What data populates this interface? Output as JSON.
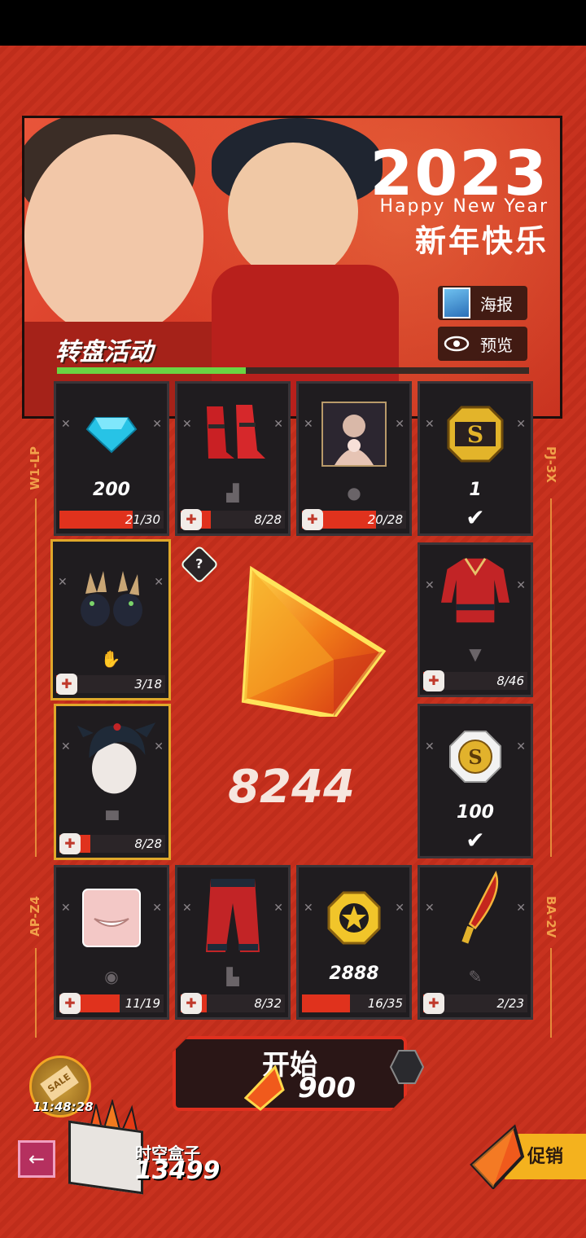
{
  "banner": {
    "year": "2023",
    "greeting_en": "Happy New Year",
    "greeting_cn": "新年快乐",
    "poster_label": "海报",
    "preview_label": "预览",
    "event_title": "转盘活动",
    "event_progress": 0.4
  },
  "side_labels": {
    "top_left": "W1-LP",
    "top_right": "PJ-3X",
    "bottom_left": "AP-Z4",
    "bottom_right": "BA-2V"
  },
  "cells": [
    {
      "name": "diamond",
      "qty": "200",
      "progress": "21/30",
      "fill": 0.7,
      "gold": false
    },
    {
      "name": "boots",
      "slot": "boots",
      "progress": "8/28",
      "fill": 0.29,
      "gold": false
    },
    {
      "name": "portrait",
      "slot": "person",
      "progress": "20/28",
      "fill": 0.71,
      "gold": false
    },
    {
      "name": "s-ticket",
      "qty": "1",
      "checked": true
    },
    {
      "name": "rabbit-gloves",
      "slot": "glove",
      "progress": "3/18",
      "fill": 0.17,
      "gold": true
    },
    {
      "name": "jacket",
      "slot": "shirt",
      "progress": "8/46",
      "fill": 0.17,
      "gold": false
    },
    {
      "name": "hair",
      "slot": "hat",
      "progress": "8/28",
      "fill": 0.29,
      "gold": true
    },
    {
      "name": "s-coin",
      "qty": "100",
      "checked": true
    },
    {
      "name": "mouth",
      "slot": "lips",
      "progress": "11/19",
      "fill": 0.58,
      "gold": false
    },
    {
      "name": "pants",
      "slot": "pants",
      "progress": "8/32",
      "fill": 0.25,
      "gold": false
    },
    {
      "name": "star-coin",
      "qty": "2888",
      "progress": "16/35",
      "fill": 0.46,
      "gold": false
    },
    {
      "name": "knife",
      "slot": "weapon",
      "progress": "2/23",
      "fill": 0.09,
      "gold": false
    }
  ],
  "center": {
    "count": "8244",
    "help": "?"
  },
  "start": {
    "label": "开始",
    "cost": "900"
  },
  "bottom": {
    "sale_tag": "SALE",
    "timer": "11:48:28",
    "box_label": "时空盒子",
    "box_count": "13499",
    "promo_label": "促销",
    "back_icon": "←"
  },
  "colors": {
    "accent_red": "#e0321d",
    "gold": "#e0a82a",
    "background": "#c8321f"
  }
}
